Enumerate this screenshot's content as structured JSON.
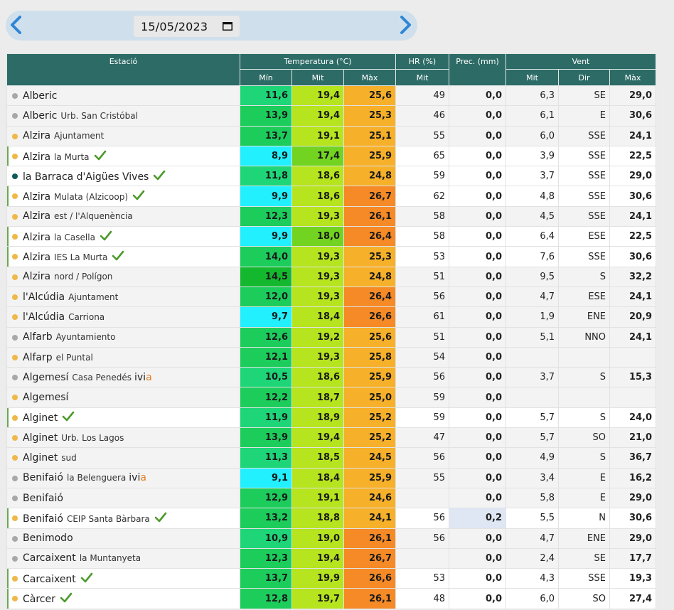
{
  "date_picker": {
    "value": "15/05/2023",
    "icons": [
      "chevron-left-icon",
      "chevron-right-icon",
      "calendar-icon"
    ]
  },
  "table": {
    "headers": {
      "station": "Estació",
      "temperature": "Temperatura (°C)",
      "humidity": "HR (%)",
      "precipitation": "Prec. (mm)",
      "wind": "Vent",
      "temp_min": "Mín",
      "temp_avg": "Mit",
      "temp_max": "Màx",
      "hr_avg": "Mit",
      "wind_avg": "Mit",
      "wind_dir": "Dir",
      "wind_max": "Màx"
    },
    "colors": {
      "dot_grey": "#a8a8a8",
      "dot_orange": "#f0b848",
      "dot_teal": "#0f5a5a",
      "check": "#4c9a2a",
      "header": "#2d6b66"
    },
    "rows": [
      {
        "name": "Alberic",
        "sub": "",
        "extra": "",
        "extra_acc": "",
        "dot": "grey",
        "check": false,
        "mark": false,
        "bg": "grey",
        "tmin": "11,6",
        "tavg": "19,4",
        "tmax": "25,6",
        "hr": "49",
        "prec": "0,0",
        "wavg": "6,3",
        "wdir": "SE",
        "wmax": "29,0",
        "cmin": "#1ed678",
        "cavg": "#b6e41e",
        "cmax": "#f6b02a"
      },
      {
        "name": "Alberic",
        "sub": "Urb. San Cristóbal",
        "extra": "",
        "extra_acc": "",
        "dot": "grey",
        "check": false,
        "mark": false,
        "bg": "grey",
        "tmin": "13,9",
        "tavg": "19,4",
        "tmax": "25,3",
        "hr": "46",
        "prec": "0,0",
        "wavg": "6,1",
        "wdir": "E",
        "wmax": "30,6",
        "cmin": "#1ccd5c",
        "cavg": "#b6e41e",
        "cmax": "#f6b02a"
      },
      {
        "name": "Alzira",
        "sub": "Ajuntament",
        "extra": "",
        "extra_acc": "",
        "dot": "orange",
        "check": false,
        "mark": false,
        "bg": "grey",
        "tmin": "13,7",
        "tavg": "19,1",
        "tmax": "25,1",
        "hr": "55",
        "prec": "0,0",
        "wavg": "6,0",
        "wdir": "SSE",
        "wmax": "24,1",
        "cmin": "#1ccd5c",
        "cavg": "#b6e41e",
        "cmax": "#f6b02a"
      },
      {
        "name": "Alzira",
        "sub": "la Murta",
        "extra": "",
        "extra_acc": "",
        "dot": "orange",
        "check": true,
        "mark": true,
        "bg": "white",
        "tmin": "8,9",
        "tavg": "17,4",
        "tmax": "25,9",
        "hr": "65",
        "prec": "0,0",
        "wavg": "3,9",
        "wdir": "SSE",
        "wmax": "22,5",
        "cmin": "#22f0ff",
        "cavg": "#72d420",
        "cmax": "#f6b02a"
      },
      {
        "name": "la Barraca d'Aigües Vives",
        "sub": "",
        "extra": "",
        "extra_acc": "",
        "dot": "teal",
        "check": true,
        "mark": false,
        "bg": "white",
        "tmin": "11,8",
        "tavg": "18,6",
        "tmax": "24,8",
        "hr": "59",
        "prec": "0,0",
        "wavg": "3,7",
        "wdir": "SSE",
        "wmax": "29,0",
        "cmin": "#1ed678",
        "cavg": "#b6e41e",
        "cmax": "#f6b02a"
      },
      {
        "name": "Alzira",
        "sub": "Mulata (Alzicoop)",
        "extra": "",
        "extra_acc": "",
        "dot": "orange",
        "check": true,
        "mark": true,
        "bg": "white",
        "tmin": "9,9",
        "tavg": "18,6",
        "tmax": "26,7",
        "hr": "62",
        "prec": "0,0",
        "wavg": "4,8",
        "wdir": "SSE",
        "wmax": "30,6",
        "cmin": "#22f0ff",
        "cavg": "#b6e41e",
        "cmax": "#f58a26"
      },
      {
        "name": "Alzira",
        "sub": "est / l'Alquenència",
        "extra": "",
        "extra_acc": "",
        "dot": "orange",
        "check": false,
        "mark": false,
        "bg": "grey",
        "tmin": "12,3",
        "tavg": "19,3",
        "tmax": "26,1",
        "hr": "58",
        "prec": "0,0",
        "wavg": "4,5",
        "wdir": "SSE",
        "wmax": "24,1",
        "cmin": "#1ccd5c",
        "cavg": "#b6e41e",
        "cmax": "#f58a26"
      },
      {
        "name": "Alzira",
        "sub": "la Casella",
        "extra": "",
        "extra_acc": "",
        "dot": "orange",
        "check": true,
        "mark": true,
        "bg": "white",
        "tmin": "9,9",
        "tavg": "18,0",
        "tmax": "26,4",
        "hr": "58",
        "prec": "0,0",
        "wavg": "6,4",
        "wdir": "ESE",
        "wmax": "22,5",
        "cmin": "#22f0ff",
        "cavg": "#72d420",
        "cmax": "#f58a26"
      },
      {
        "name": "Alzira",
        "sub": "IES La Murta",
        "extra": "",
        "extra_acc": "",
        "dot": "orange",
        "check": true,
        "mark": true,
        "bg": "white",
        "tmin": "14,0",
        "tavg": "19,3",
        "tmax": "25,3",
        "hr": "53",
        "prec": "0,0",
        "wavg": "7,6",
        "wdir": "SSE",
        "wmax": "30,6",
        "cmin": "#1ccd5c",
        "cavg": "#b6e41e",
        "cmax": "#f6b02a"
      },
      {
        "name": "Alzira",
        "sub": "nord / Polígon",
        "extra": "",
        "extra_acc": "",
        "dot": "orange",
        "check": false,
        "mark": false,
        "bg": "grey",
        "tmin": "14,5",
        "tavg": "19,3",
        "tmax": "24,8",
        "hr": "51",
        "prec": "0,0",
        "wavg": "9,5",
        "wdir": "S",
        "wmax": "32,2",
        "cmin": "#14b82e",
        "cavg": "#b6e41e",
        "cmax": "#f6b02a"
      },
      {
        "name": "l'Alcúdia",
        "sub": "Ajuntament",
        "extra": "",
        "extra_acc": "",
        "dot": "orange",
        "check": false,
        "mark": false,
        "bg": "grey",
        "tmin": "12,0",
        "tavg": "19,3",
        "tmax": "26,4",
        "hr": "56",
        "prec": "0,0",
        "wavg": "4,7",
        "wdir": "ESE",
        "wmax": "24,1",
        "cmin": "#1ccd5c",
        "cavg": "#b6e41e",
        "cmax": "#f58a26"
      },
      {
        "name": "l'Alcúdia",
        "sub": "Carriona",
        "extra": "",
        "extra_acc": "",
        "dot": "orange",
        "check": false,
        "mark": false,
        "bg": "grey",
        "tmin": "9,7",
        "tavg": "18,4",
        "tmax": "26,6",
        "hr": "61",
        "prec": "0,0",
        "wavg": "1,9",
        "wdir": "ENE",
        "wmax": "20,9",
        "cmin": "#22f0ff",
        "cavg": "#b6e41e",
        "cmax": "#f58a26"
      },
      {
        "name": "Alfarb",
        "sub": "Ayuntamiento",
        "extra": "",
        "extra_acc": "",
        "dot": "grey",
        "check": false,
        "mark": false,
        "bg": "grey",
        "tmin": "12,6",
        "tavg": "19,2",
        "tmax": "25,6",
        "hr": "51",
        "prec": "0,0",
        "wavg": "5,1",
        "wdir": "NNO",
        "wmax": "24,1",
        "cmin": "#1ccd5c",
        "cavg": "#b6e41e",
        "cmax": "#f6b02a"
      },
      {
        "name": "Alfarp",
        "sub": "el Puntal",
        "extra": "",
        "extra_acc": "",
        "dot": "orange",
        "check": false,
        "mark": false,
        "bg": "grey",
        "tmin": "12,1",
        "tavg": "19,3",
        "tmax": "25,8",
        "hr": "54",
        "prec": "0,0",
        "wavg": "",
        "wdir": "",
        "wmax": "",
        "cmin": "#1ccd5c",
        "cavg": "#b6e41e",
        "cmax": "#f6b02a"
      },
      {
        "name": "Algemesí",
        "sub": "Casa Penedés",
        "extra": "ivi",
        "extra_acc": "a",
        "dot": "grey",
        "check": false,
        "mark": false,
        "bg": "grey",
        "tmin": "10,5",
        "tavg": "18,6",
        "tmax": "25,9",
        "hr": "56",
        "prec": "0,0",
        "wavg": "3,7",
        "wdir": "S",
        "wmax": "15,3",
        "cmin": "#1ed678",
        "cavg": "#b6e41e",
        "cmax": "#f6b02a"
      },
      {
        "name": "Algemesí",
        "sub": "",
        "extra": "",
        "extra_acc": "",
        "dot": "orange",
        "check": false,
        "mark": false,
        "bg": "grey",
        "tmin": "12,2",
        "tavg": "18,7",
        "tmax": "25,0",
        "hr": "59",
        "prec": "0,0",
        "wavg": "",
        "wdir": "",
        "wmax": "",
        "cmin": "#1ccd5c",
        "cavg": "#b6e41e",
        "cmax": "#f6b02a"
      },
      {
        "name": "Alginet",
        "sub": "",
        "extra": "",
        "extra_acc": "",
        "dot": "orange",
        "check": true,
        "mark": true,
        "bg": "white",
        "tmin": "11,9",
        "tavg": "18,9",
        "tmax": "25,2",
        "hr": "59",
        "prec": "0,0",
        "wavg": "5,7",
        "wdir": "S",
        "wmax": "24,0",
        "cmin": "#1ed678",
        "cavg": "#b6e41e",
        "cmax": "#f6b02a"
      },
      {
        "name": "Alginet",
        "sub": "Urb. Los Lagos",
        "extra": "",
        "extra_acc": "",
        "dot": "orange",
        "check": false,
        "mark": false,
        "bg": "grey",
        "tmin": "13,9",
        "tavg": "19,4",
        "tmax": "25,2",
        "hr": "47",
        "prec": "0,0",
        "wavg": "5,7",
        "wdir": "SO",
        "wmax": "21,0",
        "cmin": "#1ccd5c",
        "cavg": "#b6e41e",
        "cmax": "#f6b02a"
      },
      {
        "name": "Alginet",
        "sub": "sud",
        "extra": "",
        "extra_acc": "",
        "dot": "orange",
        "check": false,
        "mark": false,
        "bg": "grey",
        "tmin": "11,3",
        "tavg": "18,5",
        "tmax": "24,5",
        "hr": "56",
        "prec": "0,0",
        "wavg": "4,9",
        "wdir": "S",
        "wmax": "36,7",
        "cmin": "#1ed678",
        "cavg": "#b6e41e",
        "cmax": "#f6b02a"
      },
      {
        "name": "Benifaió",
        "sub": "la Belenguera",
        "extra": "ivi",
        "extra_acc": "a",
        "dot": "grey",
        "check": false,
        "mark": false,
        "bg": "grey",
        "tmin": "9,1",
        "tavg": "18,4",
        "tmax": "25,9",
        "hr": "55",
        "prec": "0,0",
        "wavg": "3,4",
        "wdir": "E",
        "wmax": "16,2",
        "cmin": "#22f0ff",
        "cavg": "#b6e41e",
        "cmax": "#f6b02a"
      },
      {
        "name": "Benifaió",
        "sub": "",
        "extra": "",
        "extra_acc": "",
        "dot": "grey",
        "check": false,
        "mark": false,
        "bg": "grey",
        "tmin": "12,9",
        "tavg": "19,1",
        "tmax": "24,6",
        "hr": "",
        "prec": "0,0",
        "wavg": "5,8",
        "wdir": "E",
        "wmax": "29,0",
        "cmin": "#1ccd5c",
        "cavg": "#b6e41e",
        "cmax": "#f6b02a"
      },
      {
        "name": "Benifaió",
        "sub": "CEIP Santa Bàrbara",
        "extra": "",
        "extra_acc": "",
        "dot": "orange",
        "check": true,
        "mark": true,
        "bg": "white",
        "tmin": "13,2",
        "tavg": "18,8",
        "tmax": "24,1",
        "hr": "56",
        "prec": "0,2",
        "wavg": "5,5",
        "wdir": "N",
        "wmax": "30,6",
        "cmin": "#1ccd5c",
        "cavg": "#b6e41e",
        "cmax": "#f6b02a",
        "prec_hl": true
      },
      {
        "name": "Benimodo",
        "sub": "",
        "extra": "",
        "extra_acc": "",
        "dot": "grey",
        "check": false,
        "mark": false,
        "bg": "grey",
        "tmin": "10,9",
        "tavg": "19,0",
        "tmax": "26,1",
        "hr": "56",
        "prec": "0,0",
        "wavg": "4,7",
        "wdir": "ENE",
        "wmax": "29,0",
        "cmin": "#1ed678",
        "cavg": "#b6e41e",
        "cmax": "#f58a26"
      },
      {
        "name": "Carcaixent",
        "sub": "la Muntanyeta",
        "extra": "",
        "extra_acc": "",
        "dot": "grey",
        "check": false,
        "mark": false,
        "bg": "grey",
        "tmin": "12,3",
        "tavg": "19,4",
        "tmax": "26,7",
        "hr": "",
        "prec": "0,0",
        "wavg": "2,4",
        "wdir": "SE",
        "wmax": "17,7",
        "cmin": "#1ccd5c",
        "cavg": "#b6e41e",
        "cmax": "#f58a26"
      },
      {
        "name": "Carcaixent",
        "sub": "",
        "extra": "",
        "extra_acc": "",
        "dot": "orange",
        "check": true,
        "mark": true,
        "bg": "white",
        "tmin": "13,7",
        "tavg": "19,9",
        "tmax": "26,6",
        "hr": "53",
        "prec": "0,0",
        "wavg": "4,3",
        "wdir": "SSE",
        "wmax": "19,3",
        "cmin": "#1ccd5c",
        "cavg": "#b6e41e",
        "cmax": "#f58a26"
      },
      {
        "name": "Càrcer",
        "sub": "",
        "extra": "",
        "extra_acc": "",
        "dot": "orange",
        "check": true,
        "mark": true,
        "bg": "white",
        "tmin": "12,8",
        "tavg": "19,7",
        "tmax": "26,1",
        "hr": "48",
        "prec": "0,0",
        "wavg": "6,0",
        "wdir": "SO",
        "wmax": "27,4",
        "cmin": "#1ccd5c",
        "cavg": "#b6e41e",
        "cmax": "#f58a26"
      }
    ]
  }
}
